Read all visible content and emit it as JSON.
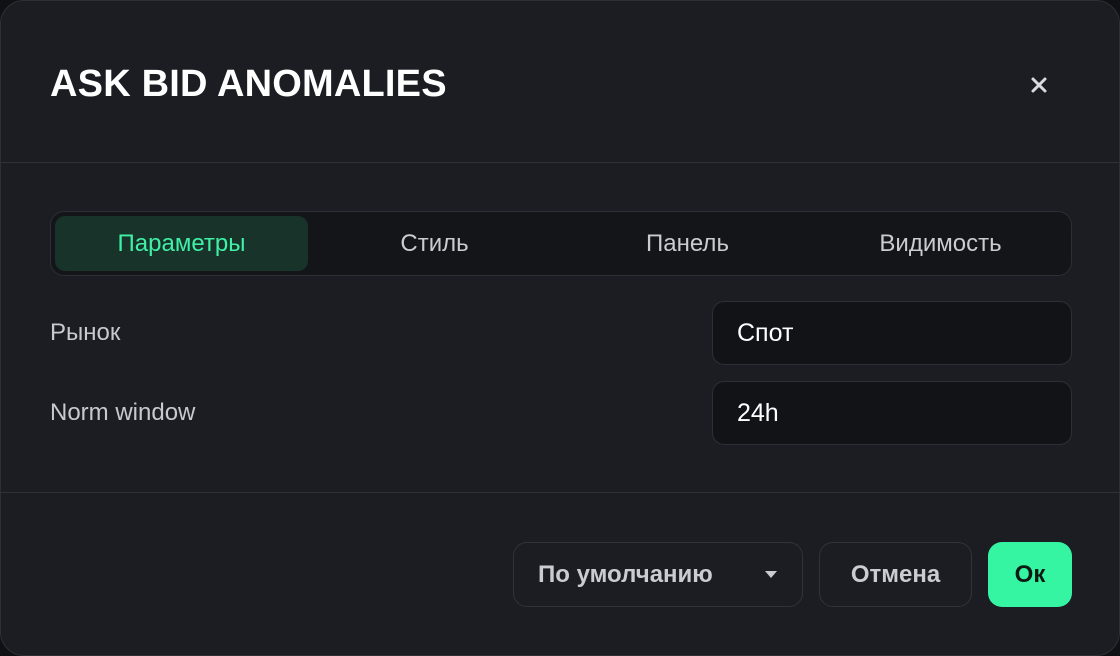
{
  "dialog": {
    "title": "ASK BID ANOMALIES"
  },
  "tabs": [
    {
      "label": "Параметры",
      "active": true
    },
    {
      "label": "Стиль",
      "active": false
    },
    {
      "label": "Панель",
      "active": false
    },
    {
      "label": "Видимость",
      "active": false
    }
  ],
  "params": {
    "market": {
      "label": "Рынок",
      "value": "Спот"
    },
    "norm_window": {
      "label": "Norm window",
      "value": "24h"
    }
  },
  "footer": {
    "defaults_label": "По умолчанию",
    "cancel_label": "Отмена",
    "ok_label": "Ок"
  },
  "icons": {
    "close": "close-icon",
    "caret": "caret-down-icon"
  },
  "colors": {
    "accent": "#35f5a2",
    "active_tab_text": "#3ff0a6",
    "active_tab_bg": "#17332a",
    "dialog_bg": "#1b1d22"
  }
}
